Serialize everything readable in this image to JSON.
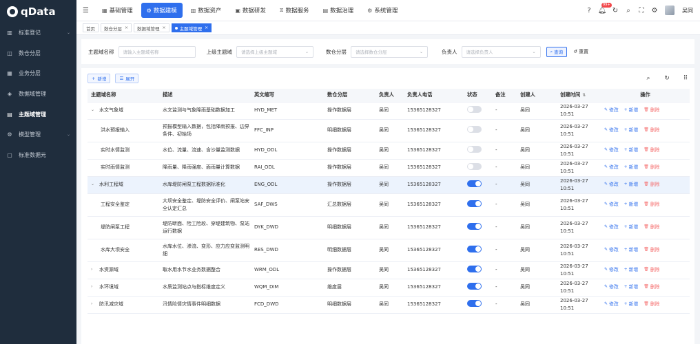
{
  "app": {
    "logo_text": "qData",
    "user_name": "吴同",
    "notification_count": "99+"
  },
  "sidebar": {
    "items": [
      {
        "label": "标准登记",
        "icon": "book-icon",
        "glyph": "▥",
        "has_children": true,
        "active": false
      },
      {
        "label": "数仓分层",
        "icon": "layers-icon",
        "glyph": "◫",
        "has_children": false,
        "active": false
      },
      {
        "label": "业务分层",
        "icon": "grid-icon",
        "glyph": "▦",
        "has_children": false,
        "active": false
      },
      {
        "label": "数据域管理",
        "icon": "database-icon",
        "glyph": "◈",
        "has_children": false,
        "active": false
      },
      {
        "label": "主题域管理",
        "icon": "topic-icon",
        "glyph": "▤",
        "has_children": false,
        "active": true
      },
      {
        "label": "模型管理",
        "icon": "model-icon",
        "glyph": "⚙",
        "has_children": true,
        "active": false
      },
      {
        "label": "标准数据元",
        "icon": "element-icon",
        "glyph": "▢",
        "has_children": false,
        "active": false
      }
    ]
  },
  "topnav": {
    "items": [
      {
        "label": "基础管理",
        "glyph": "▦",
        "active": false
      },
      {
        "label": "数据建模",
        "glyph": "⚙",
        "active": true
      },
      {
        "label": "数据资产",
        "glyph": "▥",
        "active": false
      },
      {
        "label": "数据研发",
        "glyph": "▣",
        "active": false
      },
      {
        "label": "数据服务",
        "glyph": "⧖",
        "active": false
      },
      {
        "label": "数据治理",
        "glyph": "▤",
        "active": false
      },
      {
        "label": "系统管理",
        "glyph": "⚙",
        "active": false
      }
    ]
  },
  "tabs": [
    {
      "label": "首页",
      "closable": false,
      "active": false
    },
    {
      "label": "数仓分层",
      "closable": true,
      "active": false
    },
    {
      "label": "数据域管理",
      "closable": true,
      "active": false
    },
    {
      "label": "主题域管理",
      "closable": true,
      "active": true
    }
  ],
  "search": {
    "name_label": "主题域名称",
    "name_placeholder": "请输入主题域名称",
    "parent_label": "上级主题域",
    "parent_placeholder": "请选择上级主题域",
    "layer_label": "数仓分层",
    "layer_placeholder": "请选择数仓分层",
    "owner_label": "负责人",
    "owner_placeholder": "请选择负责人",
    "query_label": "查询",
    "reset_label": "重置"
  },
  "toolbar": {
    "add_label": "新增",
    "expand_label": "展开"
  },
  "table": {
    "headers": [
      "主题域名称",
      "描述",
      "英文缩写",
      "数仓分层",
      "负责人",
      "负责人电话",
      "状态",
      "备注",
      "创建人",
      "创建时间",
      "操作"
    ],
    "actions": {
      "edit": "修改",
      "add": "新增",
      "delete": "删除"
    },
    "rows": [
      {
        "name": "水文气象域",
        "level": 0,
        "expand": "expanded",
        "desc": "水文监测与气象降雨基础数据加工",
        "abbr": "HYD_MET",
        "layer": "操作数据层",
        "owner": "吴同",
        "phone": "15365128327",
        "status": false,
        "note": "-",
        "creator": "吴同",
        "created": "2026-03-27 10:51",
        "tall": false,
        "highlight": false
      },
      {
        "name": "洪水预报输入",
        "level": 1,
        "expand": "",
        "desc": "预报模型输入数据，包括降雨预报、边界条件、初始场",
        "abbr": "FFC_INP",
        "layer": "明细数据层",
        "owner": "吴同",
        "phone": "15365128327",
        "status": false,
        "note": "-",
        "creator": "吴同",
        "created": "2026-03-27 10:51",
        "tall": true,
        "highlight": false
      },
      {
        "name": "实时水情监测",
        "level": 1,
        "expand": "",
        "desc": "水位、流量、流速、含沙量监测数据",
        "abbr": "HYD_ODL",
        "layer": "操作数据层",
        "owner": "吴同",
        "phone": "15365128327",
        "status": false,
        "note": "-",
        "creator": "吴同",
        "created": "2026-03-27 10:51",
        "tall": false,
        "highlight": false
      },
      {
        "name": "实时雨情监测",
        "level": 1,
        "expand": "",
        "desc": "降雨量、降雨强度、面雨量计算数据",
        "abbr": "RAI_ODL",
        "layer": "操作数据层",
        "owner": "吴同",
        "phone": "15365128327",
        "status": false,
        "note": "-",
        "creator": "吴同",
        "created": "2026-03-27 10:51",
        "tall": false,
        "highlight": false
      },
      {
        "name": "水利工程域",
        "level": 0,
        "expand": "expanded",
        "desc": "水库堤防闸泵工程数据标准化",
        "abbr": "ENG_ODL",
        "layer": "操作数据层",
        "owner": "吴同",
        "phone": "15365128327",
        "status": true,
        "note": "-",
        "creator": "吴同",
        "created": "2026-03-27 10:51",
        "tall": false,
        "highlight": true
      },
      {
        "name": "工程安全鉴定",
        "level": 1,
        "expand": "",
        "desc": "大坝安全鉴定、堤防安全评价、闸泵站安全认定汇总",
        "abbr": "SAF_DWS",
        "layer": "汇总数据层",
        "owner": "吴同",
        "phone": "15365128327",
        "status": true,
        "note": "-",
        "creator": "吴同",
        "created": "2026-03-27 10:51",
        "tall": true,
        "highlight": false
      },
      {
        "name": "堤防闸泵工程",
        "level": 1,
        "expand": "",
        "desc": "堤防断面、险工险段、穿堤建筑物、泵站运行数据",
        "abbr": "DYK_DWD",
        "layer": "明细数据层",
        "owner": "吴同",
        "phone": "15365128327",
        "status": true,
        "note": "-",
        "creator": "吴同",
        "created": "2026-03-27 10:51",
        "tall": true,
        "highlight": false
      },
      {
        "name": "水库大坝安全",
        "level": 1,
        "expand": "",
        "desc": "水库水位、渗流、变形、应力应变监测明细",
        "abbr": "RES_DWD",
        "layer": "明细数据层",
        "owner": "吴同",
        "phone": "15365128327",
        "status": true,
        "note": "-",
        "creator": "吴同",
        "created": "2026-03-27 10:51",
        "tall": true,
        "highlight": false
      },
      {
        "name": "水资源域",
        "level": 0,
        "expand": "collapsed",
        "desc": "取水用水节水业务数据整合",
        "abbr": "WRM_ODL",
        "layer": "操作数据层",
        "owner": "吴同",
        "phone": "15365128327",
        "status": true,
        "note": "-",
        "creator": "吴同",
        "created": "2026-03-27 10:51",
        "tall": false,
        "highlight": false
      },
      {
        "name": "水环境域",
        "level": 0,
        "expand": "collapsed",
        "desc": "水质监测站点与指标维度定义",
        "abbr": "WQM_DIM",
        "layer": "维度层",
        "owner": "吴同",
        "phone": "15365128327",
        "status": true,
        "note": "-",
        "creator": "吴同",
        "created": "2026-03-27 10:51",
        "tall": false,
        "highlight": false
      },
      {
        "name": "防汛减灾域",
        "level": 0,
        "expand": "collapsed",
        "desc": "汛情险情灾情事件明细数据",
        "abbr": "FCD_DWD",
        "layer": "明细数据层",
        "owner": "吴同",
        "phone": "15365128327",
        "status": true,
        "note": "-",
        "creator": "吴同",
        "created": "2026-03-27 10:51",
        "tall": false,
        "highlight": false
      }
    ]
  }
}
